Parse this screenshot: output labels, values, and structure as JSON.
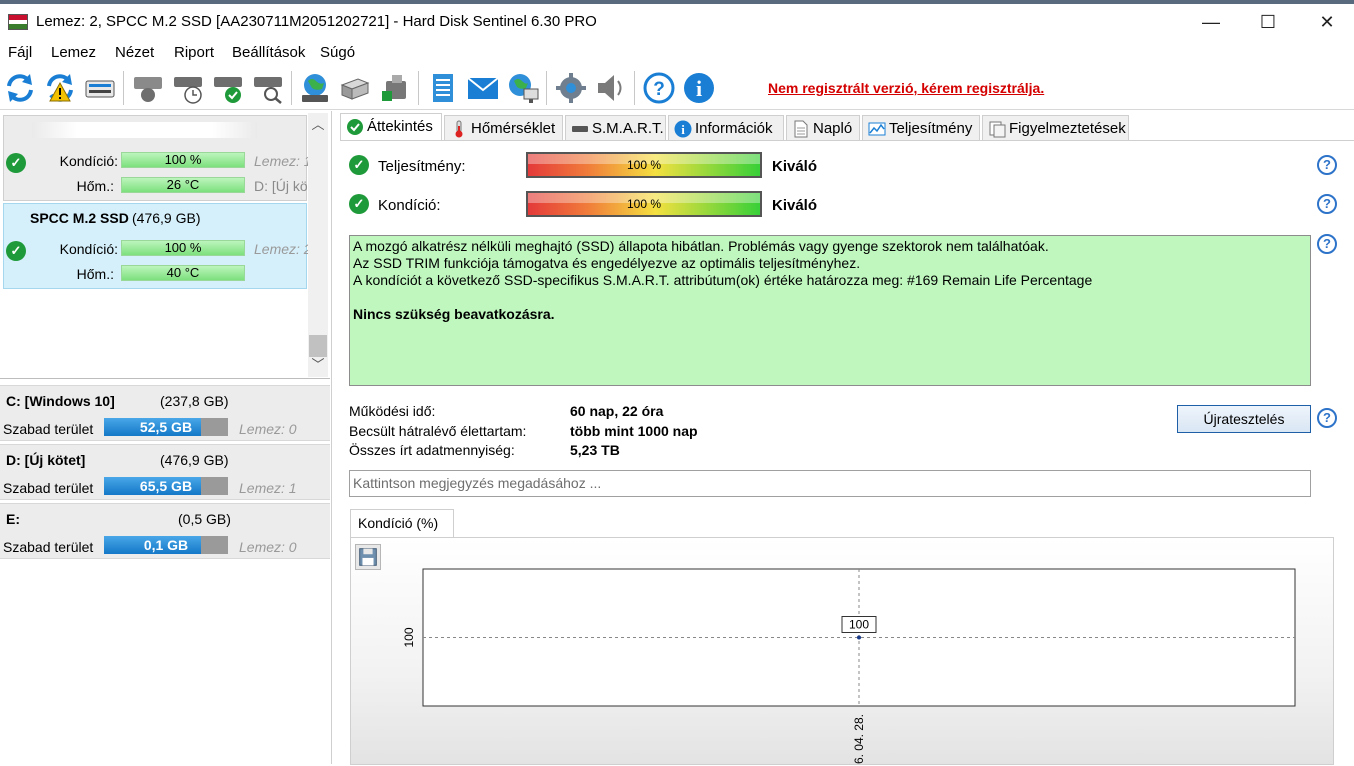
{
  "window": {
    "title": "Lemez: 2, SPCC M.2 SSD [AA230711M2051202721]  -  Hard Disk Sentinel 6.30 PRO",
    "minimize": "—",
    "maximize": "☐",
    "close": "✕"
  },
  "menu": [
    "Fájl",
    "Lemez",
    "Nézet",
    "Riport",
    "Beállítások",
    "Súgó"
  ],
  "toolbar": {
    "icons": [
      "refresh-icon",
      "refresh-warning-icon",
      "disk-icon",
      "disk-info-icon",
      "disk-schedule-icon",
      "disk-check-icon",
      "disk-search-icon",
      "globe-disk-icon",
      "hdd-stack-icon",
      "usb-drive-icon",
      "report-icon",
      "email-icon",
      "network-icon",
      "settings-icon",
      "sound-icon",
      "help-icon",
      "info-icon"
    ],
    "register_link": "Nem regisztrált verzió, kérem regisztrálja."
  },
  "disks": [
    {
      "name": "",
      "kondicio_label": "Kondíció:",
      "kondicio": "100 %",
      "kondicio_extra": "Lemez: 1",
      "hom_label": "Hőm.:",
      "hom": "26 °C",
      "hom_extra": "D: [Új kö",
      "selected": false
    },
    {
      "name": "SPCC M.2 SSD",
      "size": "(476,9 GB)",
      "kondicio_label": "Kondíció:",
      "kondicio": "100 %",
      "kondicio_extra": "Lemez: 2",
      "hom_label": "Hőm.:",
      "hom": "40 °C",
      "selected": true
    }
  ],
  "volumes": [
    {
      "name": "C: [Windows 10]",
      "size": "(237,8 GB)",
      "free_label": "Szabad terület",
      "free": "52,5 GB",
      "free_fraction": 0.78,
      "disk": "Lemez: 0"
    },
    {
      "name": "D: [Új kötet]",
      "size": "(476,9 GB)",
      "free_label": "Szabad terület",
      "free": "65,5 GB",
      "free_fraction": 0.78,
      "disk": "Lemez: 1"
    },
    {
      "name": "E:",
      "size": "(0,5 GB)",
      "free_label": "Szabad terület",
      "free": "0,1 GB",
      "free_fraction": 0.78,
      "disk": "Lemez: 0"
    }
  ],
  "tabs": [
    "Áttekintés",
    "Hőmérséklet",
    "S.M.A.R.T.",
    "Információk",
    "Napló",
    "Teljesítmény",
    "Figyelmeztetések"
  ],
  "overview": {
    "performance_label": "Teljesítmény:",
    "performance_value": "100 %",
    "performance_verdict": "Kiváló",
    "condition_label": "Kondíció:",
    "condition_value": "100 %",
    "condition_verdict": "Kiváló",
    "info_lines": [
      "A mozgó alkatrész nélküli meghajtó (SSD) állapota hibátlan. Problémás vagy gyenge szektorok nem találhatóak.",
      "Az SSD TRIM funkciója támogatva és engedélyezve az optimális teljesítményhez.",
      "A kondíciót a következő SSD-specifikus S.M.A.R.T. attribútum(ok) értéke határozza meg:  #169 Remain Life Percentage"
    ],
    "info_bold": "Nincs szükség beavatkozásra.",
    "uptime_label": "Működési idő:",
    "uptime_value": "60 nap, 22 óra",
    "lifetime_label": "Becsült hátralévő élettartam:",
    "lifetime_value": "több mint 1000 nap",
    "written_label": "Összes írt adatmennyiség:",
    "written_value": "5,23 TB",
    "retest_button": "Újratesztelés",
    "note_placeholder": "Kattintson megjegyzés megadásához ...",
    "help": "?"
  },
  "chart_data": {
    "type": "line",
    "tab_label": "Kondíció  (%)",
    "x": [
      "6. 04. 28."
    ],
    "series": [
      {
        "values": [
          100
        ]
      }
    ],
    "ytick": "100",
    "xtick": "6. 04. 28.",
    "data_label": "100"
  }
}
